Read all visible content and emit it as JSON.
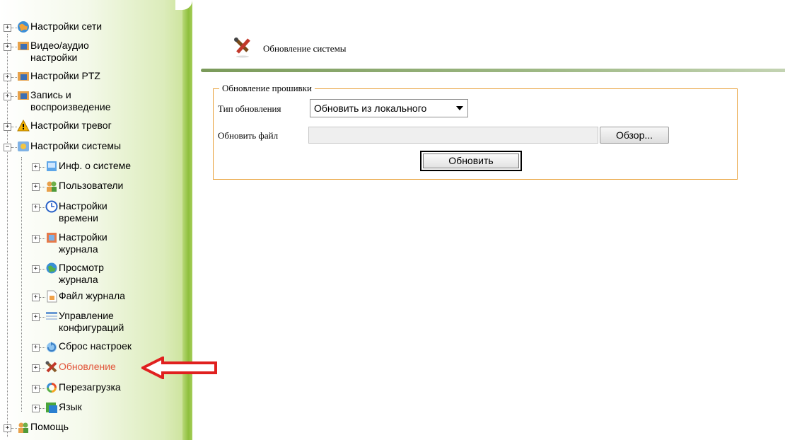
{
  "sidebar": {
    "items": [
      {
        "label": "Настройки сети",
        "expander": "+",
        "icon": "network-globe-icon"
      },
      {
        "label": "Видео/аудио\nнастройки",
        "expander": "+",
        "icon": "camera-icon"
      },
      {
        "label": "Настройки PTZ",
        "expander": "+",
        "icon": "camera-icon"
      },
      {
        "label": "Запись и\nвоспроизведение",
        "expander": "+",
        "icon": "camera-icon"
      },
      {
        "label": "Настройки тревог",
        "expander": "+",
        "icon": "warning-icon"
      },
      {
        "label": "Настройки системы",
        "expander": "−",
        "icon": "system-settings-icon"
      },
      {
        "label": "Инф. о системе",
        "expander": "+",
        "icon": "system-info-icon"
      },
      {
        "label": "Пользователи",
        "expander": "+",
        "icon": "users-icon"
      },
      {
        "label": "Настройки\nвремени",
        "expander": "+",
        "icon": "clock-icon"
      },
      {
        "label": "Настройки\nжурнала",
        "expander": "+",
        "icon": "log-settings-icon"
      },
      {
        "label": "Просмотр\nжурнала",
        "expander": "+",
        "icon": "log-view-icon"
      },
      {
        "label": "Файл журнала",
        "expander": "+",
        "icon": "log-file-icon"
      },
      {
        "label": "Управление\nконфигураций",
        "expander": "+",
        "icon": "config-icon"
      },
      {
        "label": "Сброс настроек",
        "expander": "+",
        "icon": "reset-icon"
      },
      {
        "label": "Обновление",
        "expander": "+",
        "icon": "tools-icon"
      },
      {
        "label": "Перезагрузка",
        "expander": "+",
        "icon": "reboot-icon"
      },
      {
        "label": "Язык",
        "expander": "+",
        "icon": "language-icon"
      },
      {
        "label": "Помощь",
        "expander": "+",
        "icon": "help-icon"
      }
    ],
    "active_color": "#e2553a"
  },
  "main": {
    "page_title": "Обновление системы",
    "fieldset_legend": "Обновление прошивки",
    "update_type_label": "Тип обновления",
    "update_type_value": "Обновить из локального",
    "update_file_label": "Обновить файл",
    "browse_label": "Обзор...",
    "update_button_label": "Обновить"
  },
  "colors": {
    "fieldset_border": "#e8a038",
    "sidebar_green": "#8fbf3c",
    "annotation_arrow": "#e0201f"
  }
}
